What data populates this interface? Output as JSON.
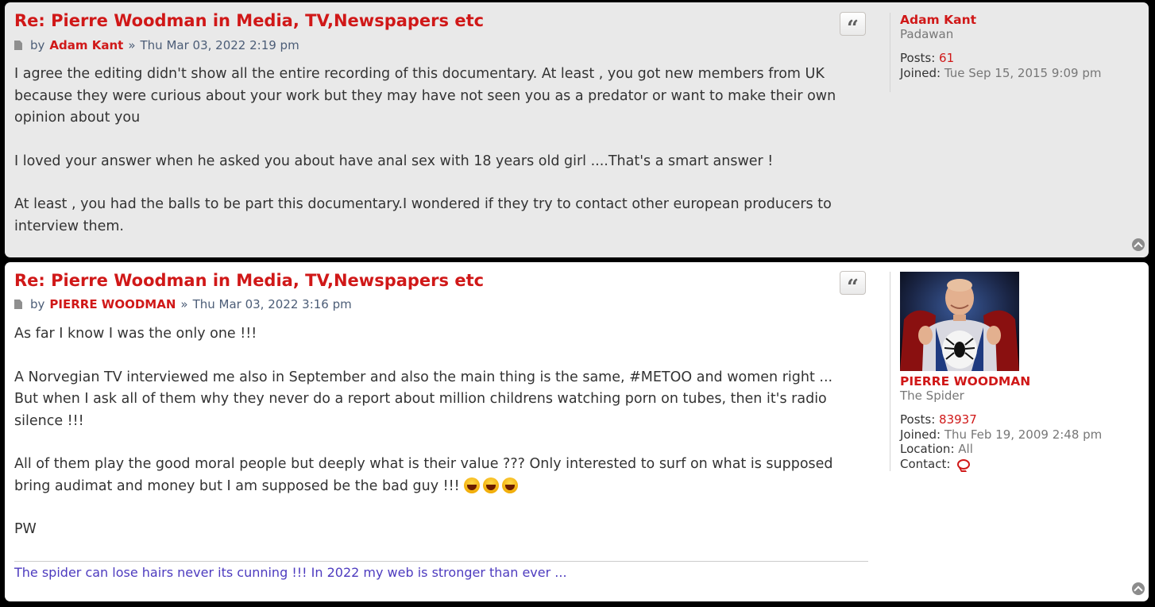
{
  "posts": [
    {
      "title": "Re: Pierre Woodman in Media, TV,Newspapers etc",
      "by_label": "by",
      "author": "Adam Kant",
      "separator": "»",
      "date": "Thu Mar 03, 2022 2:19 pm",
      "quote_icon": "quote-icon",
      "paragraphs": [
        "I agree the editing didn't show all the entire recording of this documentary. At least , you got new members from UK because they were curious about your work but they may have not seen you as a predator or want to make their own opinion about you",
        "I loved your answer when he asked you about have anal sex with 18 years old girl ....That's a smart answer !",
        "At least , you had the balls to be part this documentary.I wondered if they try to contact other european producers to interview them."
      ],
      "profile": {
        "name": "Adam Kant",
        "rank": "Padawan",
        "posts_label": "Posts:",
        "posts": "61",
        "joined_label": "Joined:",
        "joined": "Tue Sep 15, 2015 9:09 pm"
      }
    },
    {
      "title": "Re: Pierre Woodman in Media, TV,Newspapers etc",
      "by_label": "by",
      "author": "PIERRE WOODMAN",
      "separator": "»",
      "date": "Thu Mar 03, 2022 3:16 pm",
      "quote_icon": "quote-icon",
      "paragraphs": [
        "As far I know I was the only one !!!",
        "A Norvegian TV interviewed me also in September and also the main thing is the same, #METOO and women right ...",
        "But when I ask all of them why they never do a report about million childrens watching porn on tubes, then it's radio silence !!!",
        "All of them play the good moral people but deeply what is their value ??? Only interested to surf on what is supposed bring audimat and money but I am supposed be the bad guy !!!",
        "PW"
      ],
      "signature": "The spider can lose hairs never its cunning !!! In 2022 my web is stronger than ever ...",
      "profile": {
        "name": "PIERRE WOODMAN",
        "rank": "The Spider",
        "posts_label": "Posts:",
        "posts": "83937",
        "joined_label": "Joined:",
        "joined": "Thu Feb 19, 2009 2:48 pm",
        "location_label": "Location:",
        "location": "All",
        "contact_label": "Contact:",
        "contact_icon": "speech-bubble-icon",
        "avatar_icon": "avatar-image"
      }
    }
  ],
  "colors": {
    "accent": "#d01818",
    "post1_bg": "#e9e9e9",
    "post2_bg": "#ffffff",
    "signature": "#4d3bbf"
  }
}
